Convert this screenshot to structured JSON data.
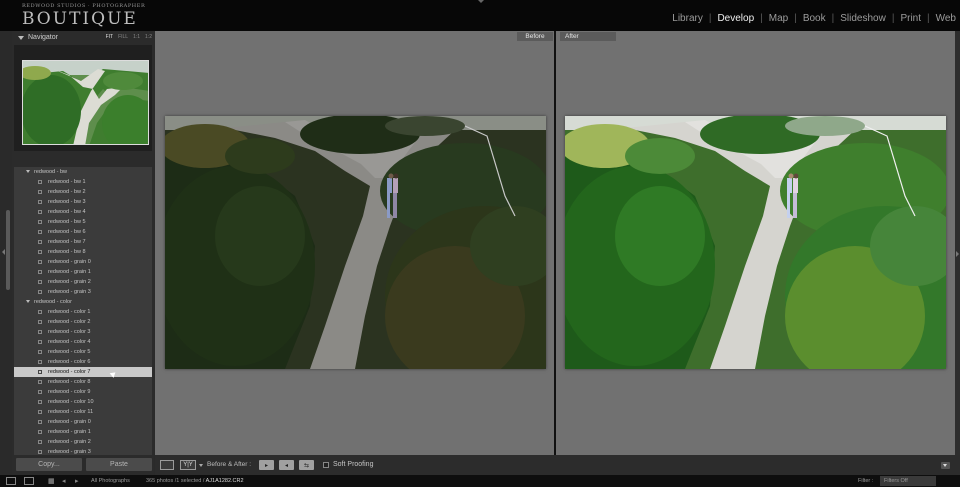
{
  "brand": {
    "subtitle": "REDWOOD STUDIOS · PHOTOGRAPHER",
    "title": "BOUTIQUE"
  },
  "modules": [
    {
      "label": "Library",
      "active": false
    },
    {
      "label": "Develop",
      "active": true
    },
    {
      "label": "Map",
      "active": false
    },
    {
      "label": "Book",
      "active": false
    },
    {
      "label": "Slideshow",
      "active": false
    },
    {
      "label": "Print",
      "active": false
    },
    {
      "label": "Web",
      "active": false
    }
  ],
  "navigator": {
    "title": "Navigator",
    "zoom_options": [
      {
        "label": "FIT",
        "active": true
      },
      {
        "label": "FILL",
        "active": false
      },
      {
        "label": "1:1",
        "active": false
      },
      {
        "label": "1:2",
        "active": false
      }
    ]
  },
  "presets": [
    {
      "label": "redwood - bw",
      "type": "folder"
    },
    {
      "label": "redwood - bw 1",
      "type": "preset"
    },
    {
      "label": "redwood - bw 2",
      "type": "preset"
    },
    {
      "label": "redwood - bw 3",
      "type": "preset"
    },
    {
      "label": "redwood - bw 4",
      "type": "preset"
    },
    {
      "label": "redwood - bw 5",
      "type": "preset"
    },
    {
      "label": "redwood - bw 6",
      "type": "preset"
    },
    {
      "label": "redwood - bw 7",
      "type": "preset"
    },
    {
      "label": "redwood - bw 8",
      "type": "preset"
    },
    {
      "label": "redwood - grain 0",
      "type": "preset"
    },
    {
      "label": "redwood - grain 1",
      "type": "preset"
    },
    {
      "label": "redwood - grain 2",
      "type": "preset"
    },
    {
      "label": "redwood - grain 3",
      "type": "preset"
    },
    {
      "label": "redwood - color",
      "type": "folder"
    },
    {
      "label": "redwood - color 1",
      "type": "preset"
    },
    {
      "label": "redwood - color 2",
      "type": "preset"
    },
    {
      "label": "redwood - color 3",
      "type": "preset"
    },
    {
      "label": "redwood - color 4",
      "type": "preset"
    },
    {
      "label": "redwood - color 5",
      "type": "preset"
    },
    {
      "label": "redwood - color 6",
      "type": "preset"
    },
    {
      "label": "redwood - color 7",
      "type": "preset",
      "selected": true
    },
    {
      "label": "redwood - color 8",
      "type": "preset"
    },
    {
      "label": "redwood - color 9",
      "type": "preset"
    },
    {
      "label": "redwood - color 10",
      "type": "preset"
    },
    {
      "label": "redwood - color 11",
      "type": "preset"
    },
    {
      "label": "redwood - grain 0",
      "type": "preset"
    },
    {
      "label": "redwood - grain 1",
      "type": "preset"
    },
    {
      "label": "redwood - grain 2",
      "type": "preset"
    },
    {
      "label": "redwood - grain 3",
      "type": "preset"
    }
  ],
  "left_buttons": {
    "copy": "Copy...",
    "paste": "Paste"
  },
  "view": {
    "before_label": "Before",
    "after_label": "After"
  },
  "toolbar": {
    "view_mode": "Y|Y",
    "before_after_label": "Before & After :",
    "soft_proofing": "Soft Proofing"
  },
  "filmstrip": {
    "source": "All Photographs",
    "count": "365 photos /1 selected /",
    "filename": "AJ1A1282.CR2",
    "filter_label": "Filter :",
    "filter_value": "Filters Off"
  },
  "icons": {
    "loupe": "single-view-icon",
    "before_after": "before-after-icon",
    "copy_settings": "copy-before-after-icon",
    "swap": "swap-icon",
    "settings": "settings-icon"
  },
  "colors": {
    "active_module": "#f0f0f0",
    "selected_preset_bg": "#c9c9c9",
    "canvas_gray": "#717171"
  }
}
